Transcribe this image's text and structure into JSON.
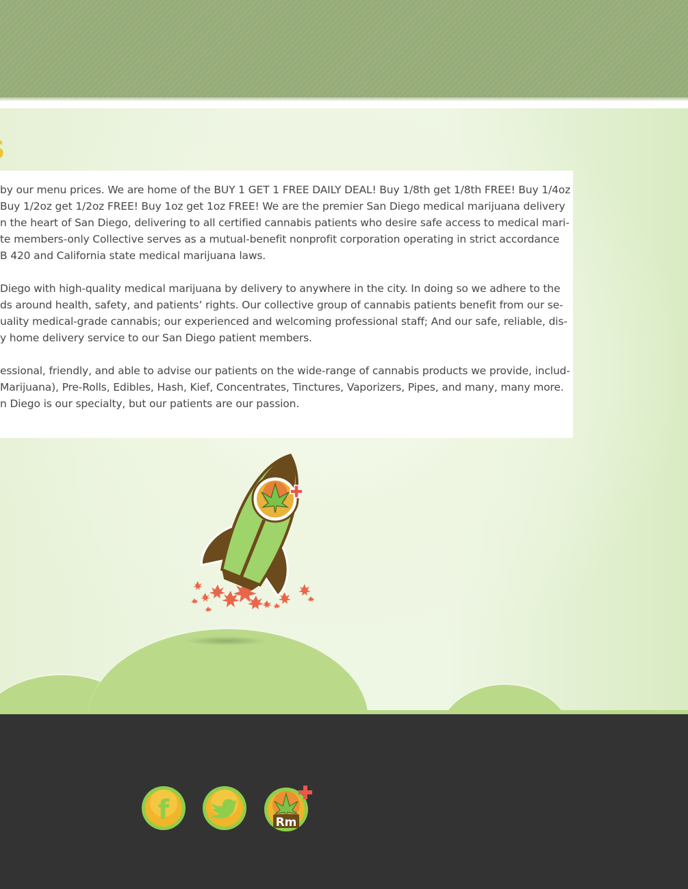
{
  "section": {
    "title": "US"
  },
  "content": {
    "paragraphs": [
      {
        "lines": [
          "by our menu prices. We are home of the BUY 1 GET 1 FREE DAILY DEAL! Buy 1/8th get 1/8th FREE! Buy 1/4oz",
          "Buy 1/2oz get 1/2oz FREE! Buy 1oz get 1oz FREE! We are the premier San Diego medical marijuana delivery",
          "n the heart of San Diego, delivering to all certified cannabis patients who desire safe access to medical mari-",
          "te members-only Collective serves as a mutual-benefit nonprofit corporation operating in strict accordance",
          "B 420 and California state medical marijuana laws."
        ]
      },
      {
        "lines": [
          "Diego with high-quality medical marijuana by delivery to anywhere in the city. In doing so we adhere to the",
          "ds around health, safety, and patients’ rights. Our collective group of cannabis patients benefit from our se-",
          "uality medical-grade cannabis; our experienced and welcoming professional staff; And our safe, reliable, dis-",
          "y home delivery service to our San Diego patient members."
        ]
      },
      {
        "lines": [
          "essional, friendly, and able to advise our patients on the wide-range of cannabis products we provide, includ-",
          "Marijuana), Pre-Rolls, Edibles, Hash, Kief, Concentrates, Tinctures, Vaporizers, Pipes, and many, many more.",
          "n Diego is our specialty, but our patients are our passion."
        ]
      }
    ]
  },
  "footer": {
    "social": [
      {
        "icon": "facebook-icon",
        "glyph": "f"
      },
      {
        "icon": "twitter-icon"
      },
      {
        "icon": "reach-marijuana-icon",
        "label": "Rm"
      }
    ]
  },
  "colors": {
    "header": "#9bb07e",
    "title": "#ecc62e",
    "hill": "#bada8a",
    "footer": "#333333",
    "text": "#474747"
  }
}
